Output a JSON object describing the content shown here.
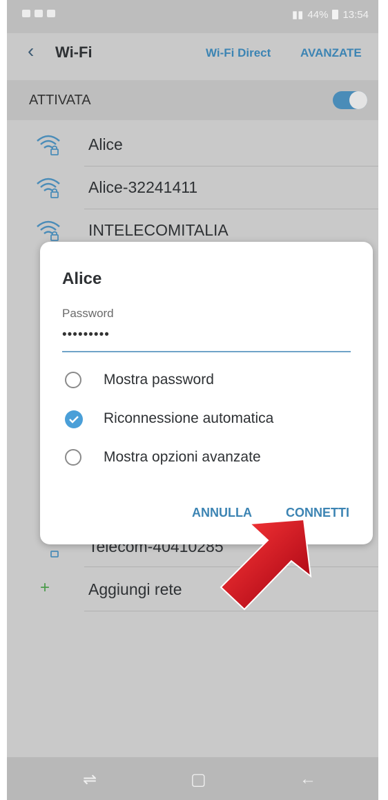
{
  "status_bar": {
    "battery": "44%",
    "time": "13:54"
  },
  "app_bar": {
    "back_icon": "back-arrow-icon",
    "title": "Wi-Fi",
    "wifi_direct": "Wi-Fi Direct",
    "advanced": "AVANZATE"
  },
  "toggle": {
    "label": "ATTIVATA",
    "state": "on"
  },
  "networks": [
    {
      "name": "Alice"
    },
    {
      "name": "Alice-32241411"
    },
    {
      "name": "INTELECOMITALIA"
    },
    {
      "name": "Telecom-40410285"
    }
  ],
  "add_network": "Aggiungi rete",
  "dialog": {
    "title": "Alice",
    "password_label": "Password",
    "password_value": "•••••••••",
    "options": [
      {
        "label": "Mostra password",
        "checked": false
      },
      {
        "label": "Riconnessione automatica",
        "checked": true
      },
      {
        "label": "Mostra opzioni avanzate",
        "checked": false
      }
    ],
    "cancel": "ANNULLA",
    "connect": "CONNETTI"
  },
  "colors": {
    "accent": "#3c84b3",
    "check": "#4a9fd8",
    "arrow": "#c8101e"
  }
}
